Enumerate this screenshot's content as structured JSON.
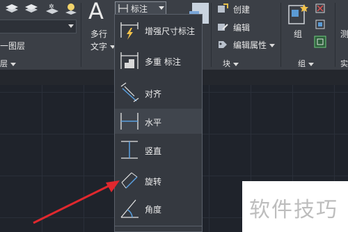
{
  "ribbon": {
    "layer_panel": {
      "match_layer_label": "一图层",
      "panel_label": "层"
    },
    "annotation": {
      "text_button_line1": "多行",
      "text_button_line2": "文字",
      "dimension_dropdown_label": "标注"
    },
    "block_panel": {
      "create_label": "创建",
      "edit_label": "编辑",
      "edit_attributes_label": "编辑属性",
      "panel_label": "块"
    },
    "group_panel": {
      "group_label": "组",
      "panel_label": "组"
    },
    "measure_panel": {
      "partial_label_top": "测",
      "partial_label_bottom": "实"
    }
  },
  "dimension_menu": {
    "items": [
      {
        "label": "增强尺寸标注",
        "icon": "smart-dimension-icon"
      },
      {
        "label": "多重 标注",
        "icon": "multiple-dimension-icon"
      },
      {
        "label": "对齐",
        "icon": "aligned-dimension-icon"
      },
      {
        "label": "水平",
        "icon": "horizontal-dimension-icon"
      },
      {
        "label": "竖直",
        "icon": "vertical-dimension-icon"
      },
      {
        "label": "旋转",
        "icon": "rotated-dimension-icon"
      },
      {
        "label": "角度",
        "icon": "angular-dimension-icon"
      }
    ],
    "highlighted_item": "水平"
  },
  "watermark": {
    "text": "软件技巧"
  },
  "colors": {
    "annotation_arrow": "#e0282e",
    "menu_bg": "#353940",
    "ribbon_bg": "#3b3f46"
  }
}
